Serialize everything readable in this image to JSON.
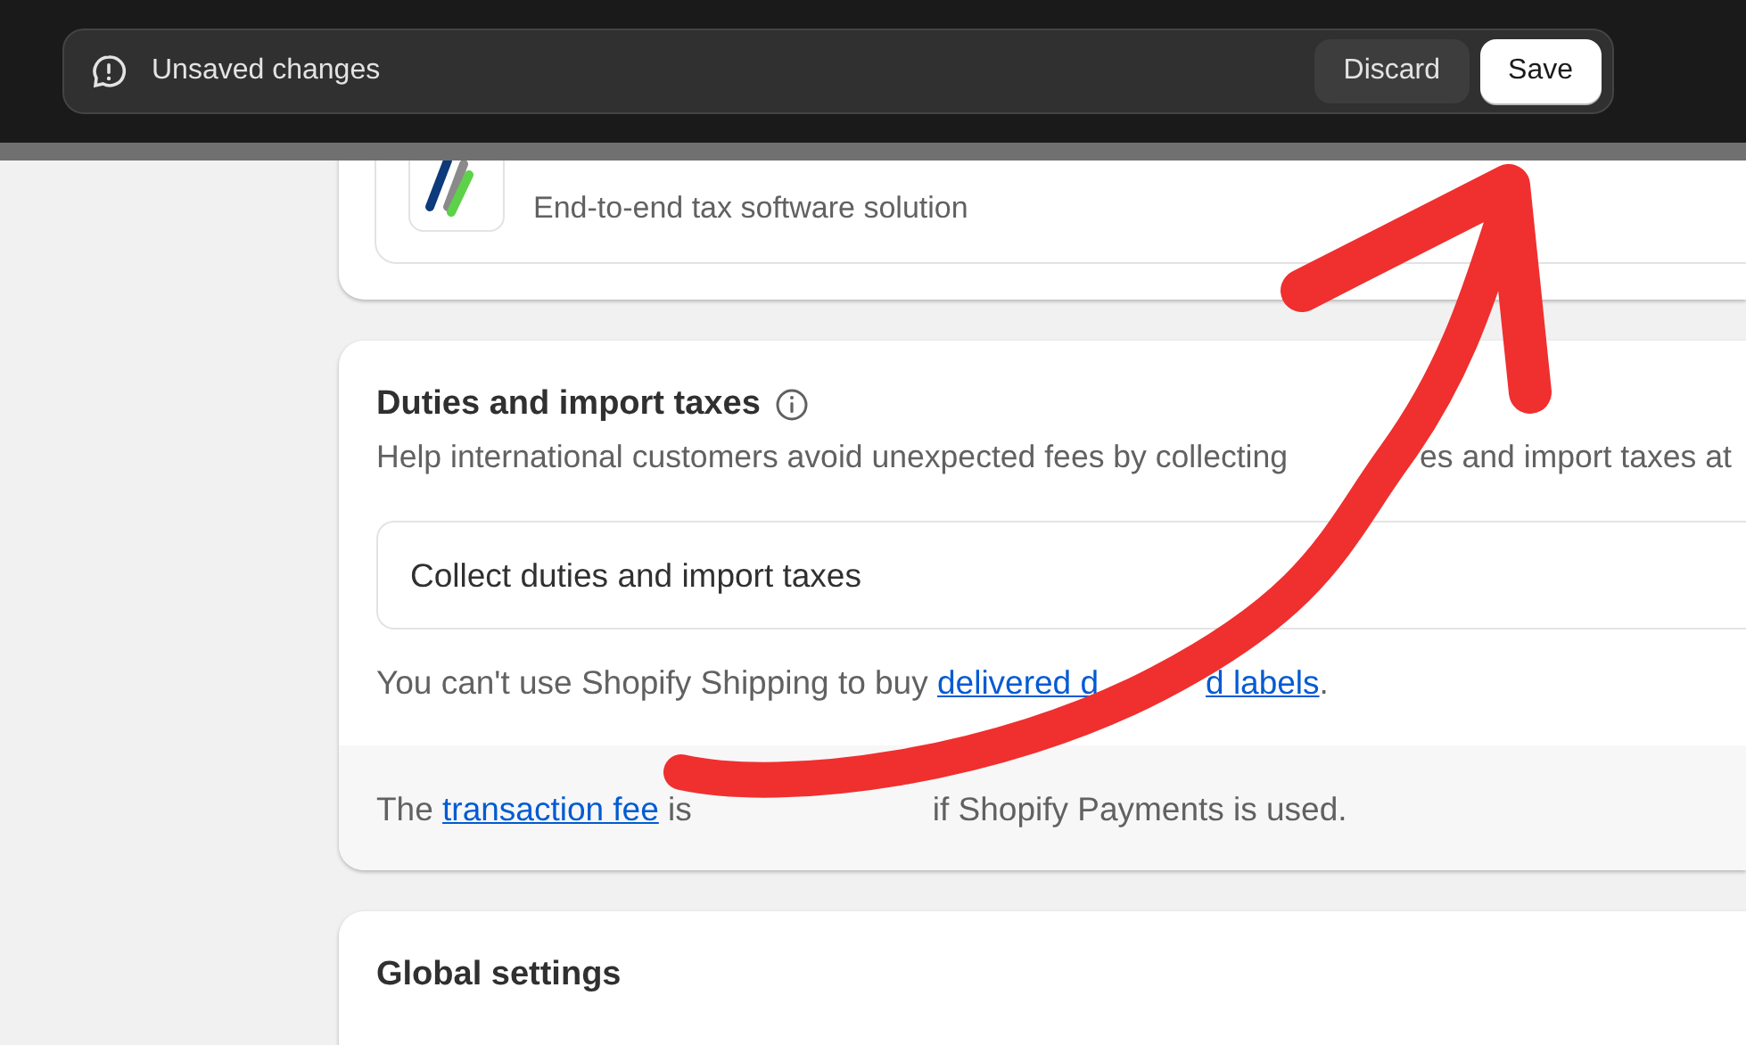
{
  "save_bar": {
    "message": "Unsaved changes",
    "buttons": [
      {
        "label": "Discard",
        "kind": "secondary"
      },
      {
        "label": "Save",
        "kind": "primary"
      }
    ]
  },
  "app_card": {
    "description": "End-to-end tax software solution"
  },
  "duties_card": {
    "title": "Duties and import taxes",
    "description_parts": [
      "Help international customers avoid unexpected fees by collecting",
      "es and import taxes at"
    ],
    "option": "Collect duties and import taxes",
    "note": {
      "text": "You can't use Shopify Shipping to buy ",
      "link_parts": [
        "delivered d",
        "d labels"
      ],
      "after": "."
    },
    "footer": {
      "text": "The ",
      "link": "transaction fee",
      "before_gap": " is",
      "after": "if Shopify Payments is used."
    }
  },
  "global_card": {
    "title": "Global settings"
  }
}
